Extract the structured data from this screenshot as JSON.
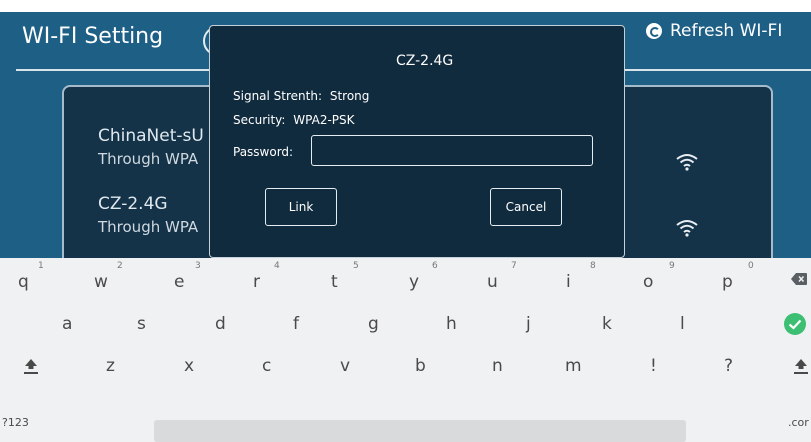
{
  "app": {
    "title": "WI-FI Setting",
    "refresh_label": "Refresh WI-FI"
  },
  "networks": [
    {
      "name": "ChinaNet-sU",
      "security": "Through WPA"
    },
    {
      "name": "CZ-2.4G",
      "security": "Through WPA"
    }
  ],
  "dialog": {
    "title": "CZ-2.4G",
    "signal_label": "Signal Strenth:",
    "signal_value": "Strong",
    "security_label": "Security:",
    "security_value": "WPA2-PSK",
    "password_label": "Password:",
    "password_value": "",
    "link_label": "Link",
    "cancel_label": "Cancel"
  },
  "keyboard": {
    "row1": [
      "q",
      "w",
      "e",
      "r",
      "t",
      "y",
      "u",
      "i",
      "o",
      "p"
    ],
    "row1_numbers": [
      "1",
      "2",
      "3",
      "4",
      "5",
      "6",
      "7",
      "8",
      "9",
      "0"
    ],
    "row2": [
      "a",
      "s",
      "d",
      "f",
      "g",
      "h",
      "j",
      "k",
      "l"
    ],
    "row3": [
      "z",
      "x",
      "c",
      "v",
      "b",
      "n",
      "m",
      "!",
      "?"
    ],
    "symbols_label": "?123",
    "dotcom_label": ".cor",
    "colors": {
      "enter_key": "#3dbf73"
    }
  }
}
